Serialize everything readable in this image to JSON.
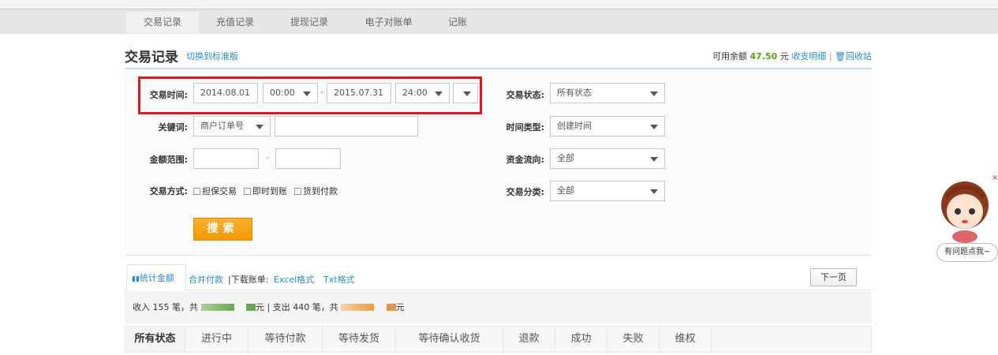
{
  "nav": {
    "tabs": [
      "交易记录",
      "充值记录",
      "提现记录",
      "电子对账单",
      "记账"
    ]
  },
  "header": {
    "title": "交易记录",
    "switch_link": "切换到标准版",
    "balance_label": "可用余额",
    "balance": "47.50",
    "unit": "元",
    "detail_link": "收支明细",
    "separator": "|",
    "recycle_link": "回收站"
  },
  "filters": {
    "time_label": "交易时间:",
    "date_from": "2014.08.01",
    "time_from": "00:00",
    "dash": "-",
    "date_to": "2015.07.31",
    "time_to": "24:00",
    "keyword_label": "关键词:",
    "keyword_type": "商户订单号",
    "keyword_value": "",
    "amount_label": "金额范围:",
    "amount_from": "",
    "amount_to": "",
    "method_label": "交易方式:",
    "methods": [
      "担保交易",
      "即时到账",
      "货到付款"
    ],
    "status_label": "交易状态:",
    "status_value": "所有状态",
    "timetype_label": "时间类型:",
    "timetype_value": "创建时间",
    "flow_label": "资金流向:",
    "flow_value": "全部",
    "category_label": "交易分类:",
    "category_value": "全部",
    "search_button": "搜索"
  },
  "toolbar": {
    "stat_tab": "统计金额",
    "merge_pay": "合并付款",
    "download_label": "|下载账单:",
    "excel": "Excel格式",
    "txt": "Txt格式",
    "next_page": "下一页"
  },
  "stats": {
    "income_text": "收入 155 笔，共",
    "income_unit": "元 | 支出 440 笔，共",
    "expense_unit": "元"
  },
  "status_tabs": [
    "所有状态",
    "进行中",
    "等待付款",
    "等待发货",
    "等待确认收货",
    "退款",
    "成功",
    "失败",
    "维权"
  ],
  "help": {
    "bubble": "有问题点我~"
  },
  "colors": {
    "accent": "#2a8cc4",
    "highlight": "#e0161b",
    "button": "#f39800",
    "balance": "#5a9e1a"
  }
}
